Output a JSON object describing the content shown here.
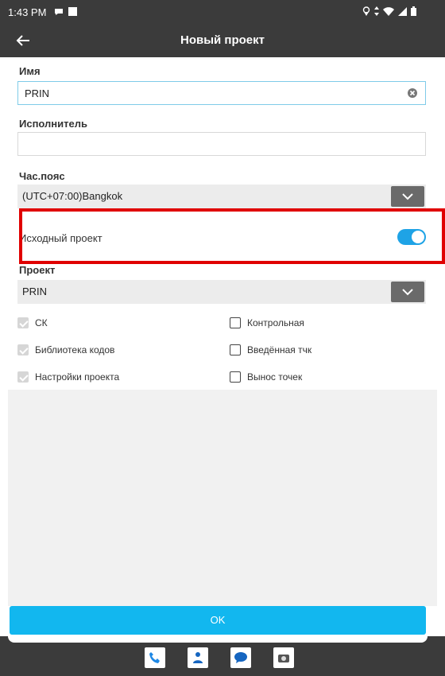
{
  "status_bar": {
    "time": "1:43 PM"
  },
  "app_bar": {
    "title": "Новый проект"
  },
  "form": {
    "name": {
      "label": "Имя",
      "value": "PRIN"
    },
    "executor": {
      "label": "Исполнитель",
      "value": ""
    },
    "timezone": {
      "label": "Час.пояс",
      "value": "(UTC+07:00)Bangkok"
    },
    "source_project": {
      "label": "Исходный проект",
      "enabled": true
    },
    "project": {
      "label": "Проект",
      "value": "PRIN"
    },
    "checkboxes_left": [
      {
        "label": "СК",
        "checked": true
      },
      {
        "label": "Библиотека кодов",
        "checked": true
      },
      {
        "label": "Настройки проекта",
        "checked": true
      }
    ],
    "checkboxes_right": [
      {
        "label": "Контрольная",
        "checked": false
      },
      {
        "label": "Введённая тчк",
        "checked": false
      },
      {
        "label": "Вынос точек",
        "checked": false
      }
    ]
  },
  "ok_button": {
    "label": "OK"
  },
  "colors": {
    "accent": "#12b7ef",
    "toggle": "#1ea3e6",
    "bar": "#3b3b3b",
    "highlight": "#e00000"
  },
  "taskbar_icons": [
    "phone-icon",
    "contacts-icon",
    "chat-icon",
    "camera-icon"
  ]
}
